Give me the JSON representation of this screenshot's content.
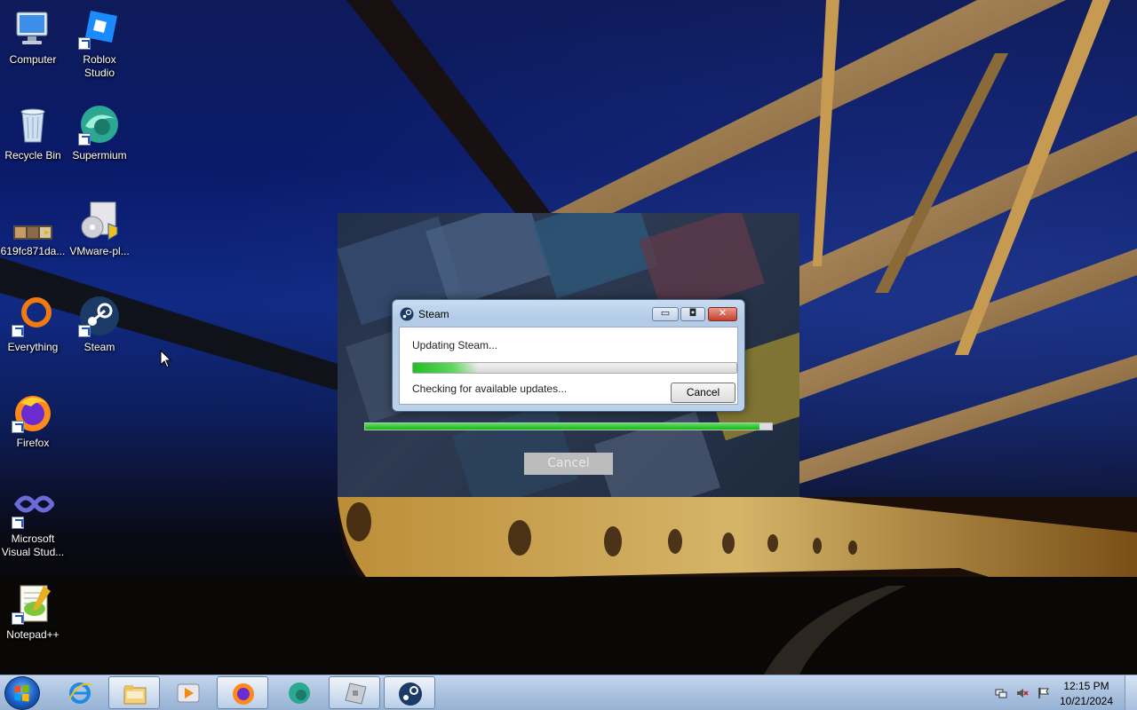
{
  "desktop": {
    "icons": [
      {
        "label": "Computer",
        "icon": "computer-icon"
      },
      {
        "label": "Roblox Studio",
        "icon": "roblox-studio-icon"
      },
      {
        "label": "Recycle Bin",
        "icon": "recycle-bin-icon"
      },
      {
        "label": "Supermium",
        "icon": "supermium-icon"
      },
      {
        "label": "619fc871da...",
        "icon": "image-file-icon"
      },
      {
        "label": "VMware-pl...",
        "icon": "vmware-installer-icon"
      },
      {
        "label": "Everything",
        "icon": "everything-search-icon"
      },
      {
        "label": "Steam",
        "icon": "steam-icon"
      },
      {
        "label": "Firefox",
        "icon": "firefox-icon"
      },
      {
        "label": "Microsoft Visual Stud...",
        "icon": "visual-studio-icon"
      },
      {
        "label": "Notepad++",
        "icon": "notepad-plus-plus-icon"
      }
    ]
  },
  "splash": {
    "progress": 0.97,
    "cancel_label": "Cancel"
  },
  "dialog": {
    "title": "Steam",
    "status": "Updating Steam...",
    "progress": 0.2,
    "detail": "Checking for available updates...",
    "cancel_label": "Cancel",
    "title_buttons": {
      "minimize": "▭",
      "maximize": "◘",
      "close": "✕"
    }
  },
  "taskbar": {
    "apps": [
      {
        "name": "Internet Explorer",
        "icon": "internet-explorer-icon",
        "active": false
      },
      {
        "name": "Windows Explorer",
        "icon": "file-explorer-icon",
        "active": true
      },
      {
        "name": "Windows Media Player",
        "icon": "media-player-icon",
        "active": false
      },
      {
        "name": "Firefox",
        "icon": "firefox-icon",
        "active": true
      },
      {
        "name": "Supermium",
        "icon": "supermium-icon",
        "active": false
      },
      {
        "name": "Roblox",
        "icon": "roblox-icon",
        "active": true
      },
      {
        "name": "Steam",
        "icon": "steam-icon",
        "active": true
      }
    ],
    "clock": {
      "time": "12:15 PM",
      "date": "10/21/2024"
    }
  },
  "colors": {
    "progress_green": "#17b317",
    "taskbar": "#adc4e0",
    "dialog_frame": "#bcd2ea"
  }
}
